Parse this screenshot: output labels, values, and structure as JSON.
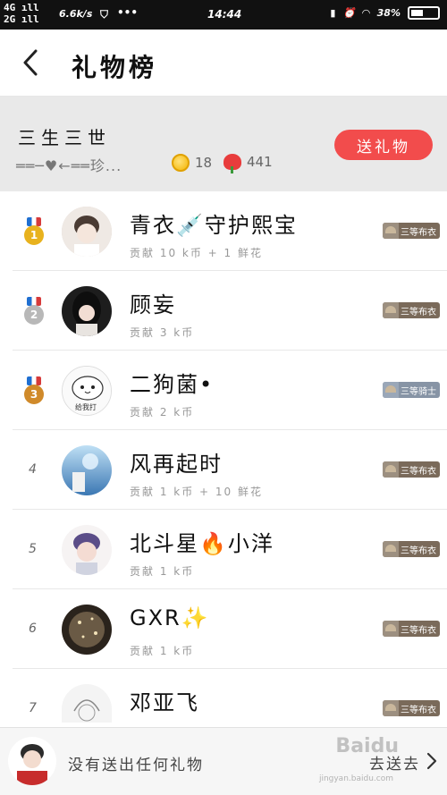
{
  "status_bar": {
    "network_top": "4G",
    "network_bottom": "2G",
    "speed": "6.6k/s",
    "time": "14:44",
    "battery": "38%"
  },
  "header": {
    "title": "礼物榜",
    "back_icon": "chevron-left-icon"
  },
  "target": {
    "name": "三生三世",
    "signature": "══─♥←══珍...",
    "coins": "18",
    "roses": "441",
    "send_label": "送礼物"
  },
  "ranking": [
    {
      "rank": "1",
      "name": "青衣💉守护熙宝",
      "detail": "贡献 10 k币 + 1 鲜花",
      "badge": "三等布衣",
      "badge_color": "#7a6a5a",
      "avatar_color": "#d9cfc6"
    },
    {
      "rank": "2",
      "name": "顾妄",
      "detail": "贡献 3 k币",
      "badge": "三等布衣",
      "badge_color": "#7a6a5a",
      "avatar_color": "#2b2b2b"
    },
    {
      "rank": "3",
      "name": "二狗菌•",
      "detail": "贡献 2 k币",
      "badge": "三等骑士",
      "badge_color": "#8794a5",
      "avatar_color": "#f0f0f0",
      "avatar_text": "给我打"
    },
    {
      "rank": "4",
      "name": "风再起时",
      "detail": "贡献 1 k币 + 10 鲜花",
      "badge": "三等布衣",
      "badge_color": "#7a6a5a",
      "avatar_color": "#6fa8d8"
    },
    {
      "rank": "5",
      "name": "北斗星🔥小洋",
      "detail": "贡献 1 k币",
      "badge": "三等布衣",
      "badge_color": "#7a6a5a",
      "avatar_color": "#e7ddd8"
    },
    {
      "rank": "6",
      "name": "GXR✨",
      "detail": "贡献 1 k币",
      "badge": "三等布衣",
      "badge_color": "#7a6a5a",
      "avatar_color": "#3a3228"
    },
    {
      "rank": "7",
      "name": "邓亚飞",
      "detail": "",
      "badge": "三等布衣",
      "badge_color": "#7a6a5a",
      "avatar_color": "#ededed"
    }
  ],
  "bottom": {
    "my_status": "没有送出任何礼物",
    "go_send": "去送去",
    "watermark": "Baidu",
    "watermark_sub": "jingyan.baidu.com",
    "chevron_icon": "chevron-right-icon"
  }
}
